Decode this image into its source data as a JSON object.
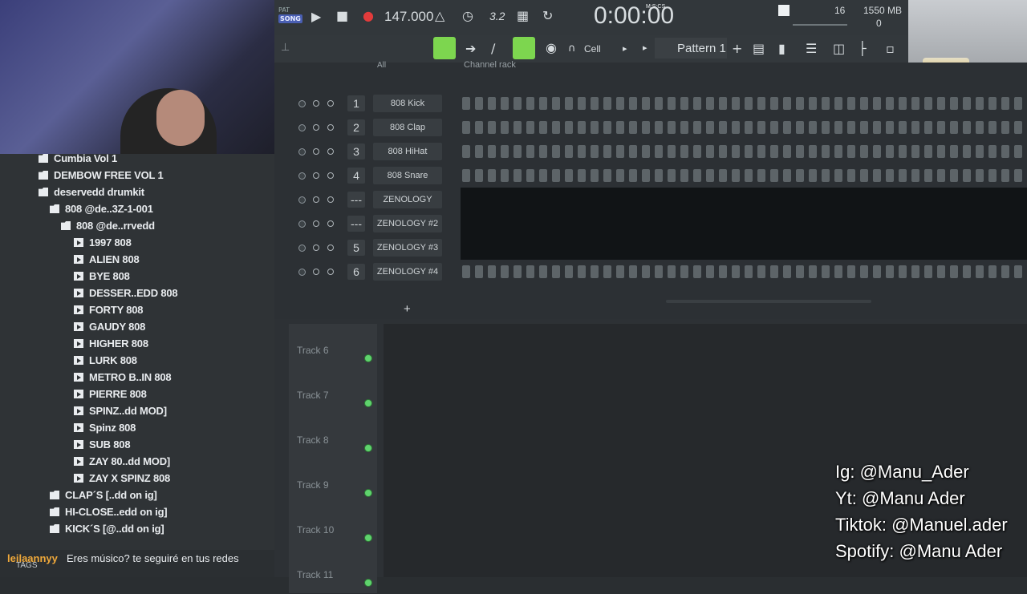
{
  "browser": {
    "items": [
      {
        "label": "Cumbia Vol 1",
        "type": "folder",
        "indent": 0
      },
      {
        "label": "DEMBOW FREE VOL 1",
        "type": "folder",
        "indent": 0
      },
      {
        "label": "deservedd drumkit",
        "type": "folder",
        "indent": 0
      },
      {
        "label": "808 @de..3Z-1-001",
        "type": "folder",
        "indent": 1
      },
      {
        "label": "808 @de..rrvedd",
        "type": "folder",
        "indent": 2
      },
      {
        "label": "1997 808",
        "type": "file",
        "indent": 3
      },
      {
        "label": "ALIEN 808",
        "type": "file",
        "indent": 3
      },
      {
        "label": "BYE 808",
        "type": "file",
        "indent": 3
      },
      {
        "label": "DESSER..EDD 808",
        "type": "file",
        "indent": 3
      },
      {
        "label": "FORTY 808",
        "type": "file",
        "indent": 3
      },
      {
        "label": "GAUDY 808",
        "type": "file",
        "indent": 3
      },
      {
        "label": "HIGHER 808",
        "type": "file",
        "indent": 3
      },
      {
        "label": "LURK 808",
        "type": "file",
        "indent": 3
      },
      {
        "label": "METRO B..IN 808",
        "type": "file",
        "indent": 3
      },
      {
        "label": "PIERRE 808",
        "type": "file",
        "indent": 3
      },
      {
        "label": "SPINZ..dd MOD]",
        "type": "file",
        "indent": 3
      },
      {
        "label": "Spinz 808",
        "type": "file",
        "indent": 3
      },
      {
        "label": "SUB 808",
        "type": "file",
        "indent": 3
      },
      {
        "label": "ZAY 80..dd MOD]",
        "type": "file",
        "indent": 3
      },
      {
        "label": "ZAY X SPINZ 808",
        "type": "file",
        "indent": 3
      },
      {
        "label": "CLAP´S [..dd on ig]",
        "type": "folder",
        "indent": 1
      },
      {
        "label": "HI-CLOSE..edd on ig]",
        "type": "folder",
        "indent": 1
      },
      {
        "label": "KICK´S [@..dd on ig]",
        "type": "folder",
        "indent": 1
      }
    ]
  },
  "chat": {
    "user": "leilaannyy",
    "message": "Eres músico? te seguiré en tus redes",
    "tags": "TAGS"
  },
  "toolbar": {
    "pat": "PAT",
    "song": "SONG",
    "tempo": "147.000",
    "time": "0:00:00",
    "time_unit": "M:S:CS",
    "cpu_value": "16",
    "memory": "1550 MB",
    "polyphony": "0",
    "snap": "Cell",
    "pattern": "Pattern 1",
    "time_sig_btn": "3.2"
  },
  "rack": {
    "header_all": "All",
    "header_title": "Channel rack",
    "channels": [
      {
        "num": "1",
        "name": "808 Kick",
        "mode": "steps"
      },
      {
        "num": "2",
        "name": "808 Clap",
        "mode": "steps"
      },
      {
        "num": "3",
        "name": "808 HiHat",
        "mode": "steps"
      },
      {
        "num": "4",
        "name": "808 Snare",
        "mode": "steps"
      },
      {
        "num": "---",
        "name": "ZENOLOGY",
        "mode": "piano"
      },
      {
        "num": "---",
        "name": "ZENOLOGY #2",
        "mode": "piano"
      },
      {
        "num": "5",
        "name": "ZENOLOGY #3",
        "mode": "piano"
      },
      {
        "num": "6",
        "name": "ZENOLOGY #4",
        "mode": "steps"
      }
    ],
    "add_label": "+"
  },
  "playlist": {
    "tracks": [
      "Track 6",
      "Track 7",
      "Track 8",
      "Track 9",
      "Track 10",
      "Track 11"
    ]
  },
  "overlay": {
    "lines": [
      "Ig: @Manu_Ader",
      "Yt: @Manu Ader",
      "Tiktok: @Manuel.ader",
      "Spotify: @Manu Ader"
    ]
  },
  "colors": {
    "accent_green": "#7dd64f",
    "record_red": "#e23b3b",
    "led_green": "#5fd36d"
  }
}
